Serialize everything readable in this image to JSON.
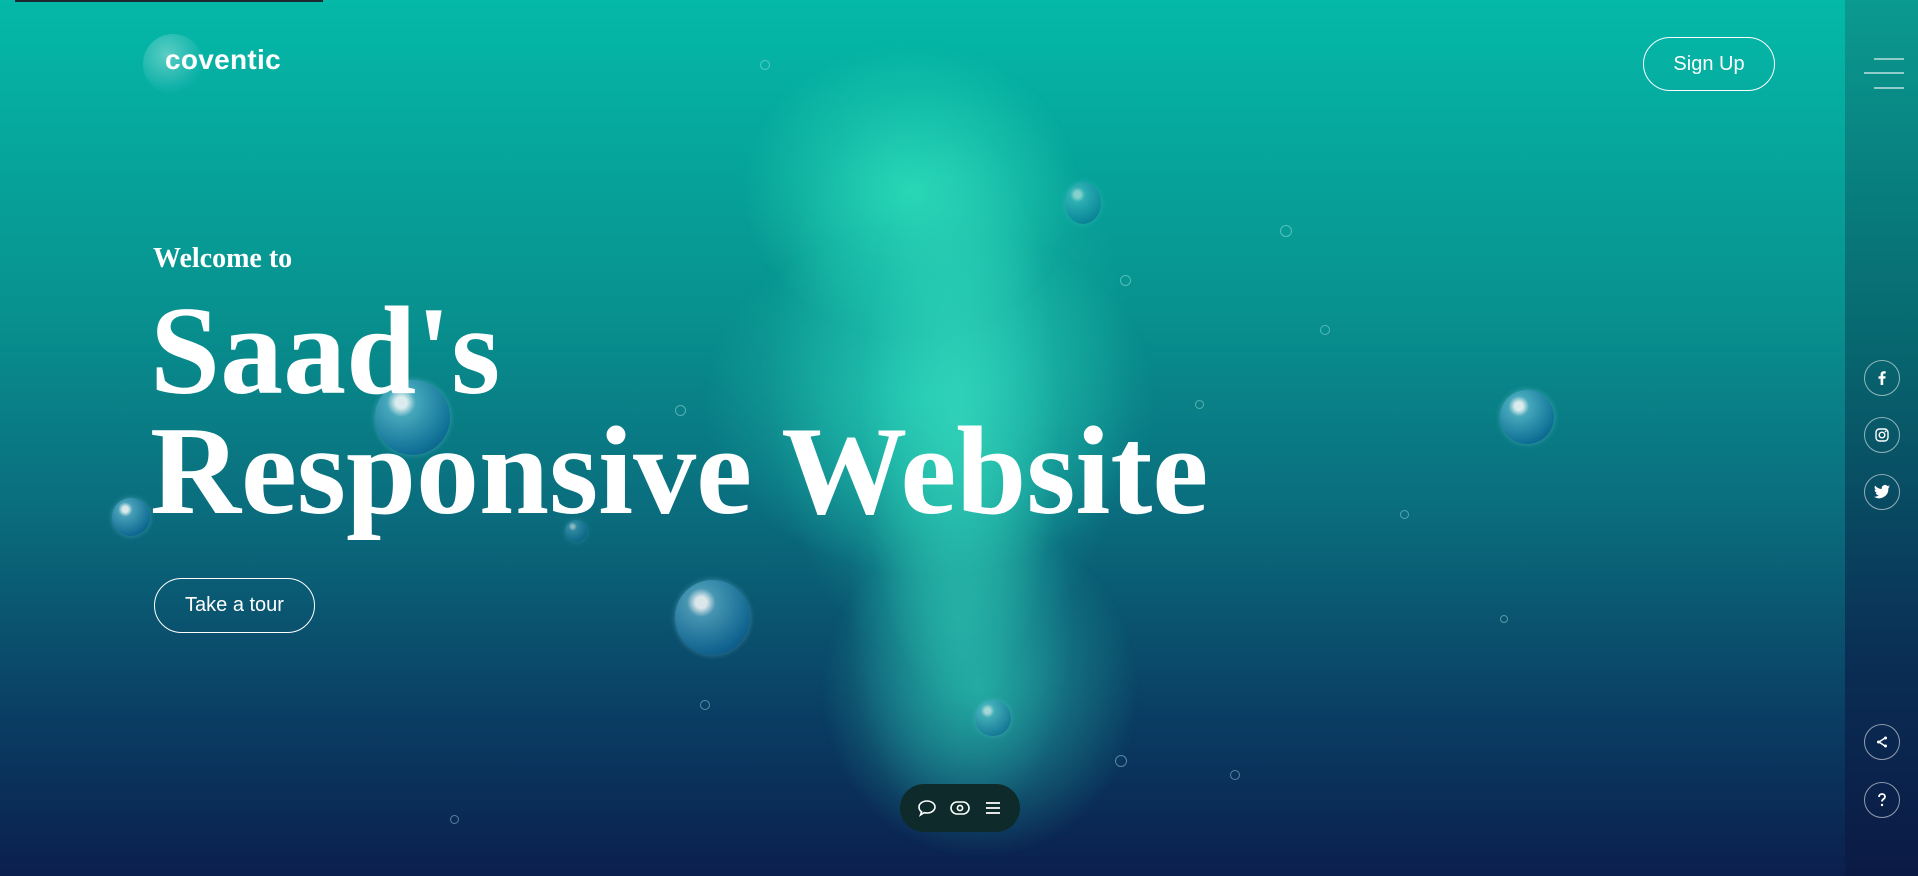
{
  "header": {
    "logo_text": "coventic",
    "signup_label": "Sign Up"
  },
  "hero": {
    "welcome": "Welcome to",
    "title_line1": "Saad's",
    "title_line2": "Responsive Website",
    "tour_label": "Take a tour"
  },
  "toolbar": {
    "icons": [
      "chat-icon",
      "eye-icon",
      "menu-icon"
    ]
  },
  "sidebar": {
    "social": [
      "facebook-icon",
      "instagram-icon",
      "twitter-icon"
    ],
    "bottom": [
      "share-icon",
      "help-icon"
    ]
  },
  "colors": {
    "accent": "#07b8a6",
    "deep": "#0b1f4e"
  }
}
